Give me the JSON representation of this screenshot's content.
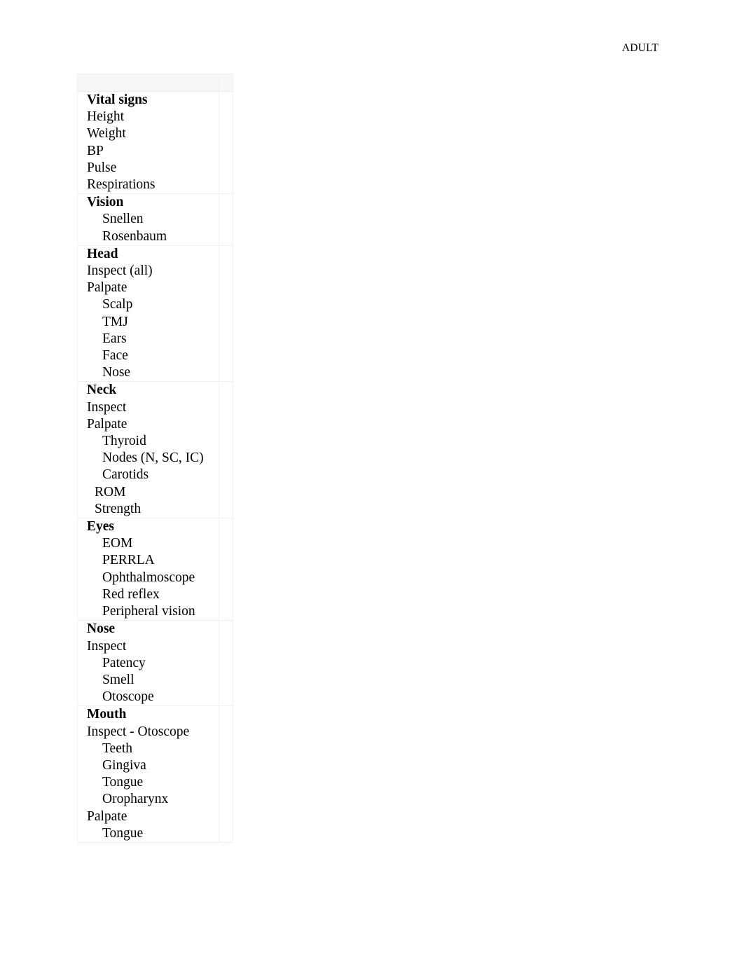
{
  "header": {
    "title": "ADULT"
  },
  "checklist": {
    "has_empty_header_row": true,
    "groups": [
      {
        "heading": "Vital signs",
        "items": [
          {
            "label": "Height",
            "level": 1
          },
          {
            "label": "Weight",
            "level": 1
          },
          {
            "label": "BP",
            "level": 1
          },
          {
            "label": "Pulse",
            "level": 1
          },
          {
            "label": "Respirations",
            "level": 1
          }
        ]
      },
      {
        "heading": "Vision",
        "items": [
          {
            "label": "Snellen",
            "level": 3
          },
          {
            "label": "Rosenbaum",
            "level": 3
          }
        ]
      },
      {
        "heading": "Head",
        "items": [
          {
            "label": "Inspect (all)",
            "level": 1
          },
          {
            "label": "Palpate",
            "level": 1
          },
          {
            "label": "Scalp",
            "level": 3
          },
          {
            "label": "TMJ",
            "level": 3
          },
          {
            "label": "Ears",
            "level": 3
          },
          {
            "label": "Face",
            "level": 3
          },
          {
            "label": "Nose",
            "level": 3
          }
        ]
      },
      {
        "heading": "Neck",
        "items": [
          {
            "label": "Inspect",
            "level": 1
          },
          {
            "label": "Palpate",
            "level": 1
          },
          {
            "label": "Thyroid",
            "level": 3
          },
          {
            "label": "Nodes (N, SC, IC)",
            "level": 3
          },
          {
            "label": "Carotids",
            "level": 3
          },
          {
            "label": "ROM",
            "level": 2
          },
          {
            "label": "Strength",
            "level": 2
          }
        ]
      },
      {
        "heading": "Eyes",
        "items": [
          {
            "label": "EOM",
            "level": 3
          },
          {
            "label": "PERRLA",
            "level": 3
          },
          {
            "label": "Ophthalmoscope",
            "level": 3
          },
          {
            "label": "Red reflex",
            "level": 3
          },
          {
            "label": "Peripheral vision",
            "level": 3
          }
        ]
      },
      {
        "heading": "Nose",
        "items": [
          {
            "label": "Inspect",
            "level": 1
          },
          {
            "label": "Patency",
            "level": 3
          },
          {
            "label": "Smell",
            "level": 3
          },
          {
            "label": "Otoscope",
            "level": 3
          }
        ]
      },
      {
        "heading": "Mouth",
        "items": [
          {
            "label": "Inspect - Otoscope",
            "level": 1
          },
          {
            "label": "Teeth",
            "level": 3
          },
          {
            "label": "Gingiva",
            "level": 3
          },
          {
            "label": "Tongue",
            "level": 3
          },
          {
            "label": "Oropharynx",
            "level": 3
          },
          {
            "label": "Palpate",
            "level": 1
          },
          {
            "label": "Tongue",
            "level": 3
          }
        ]
      }
    ]
  }
}
